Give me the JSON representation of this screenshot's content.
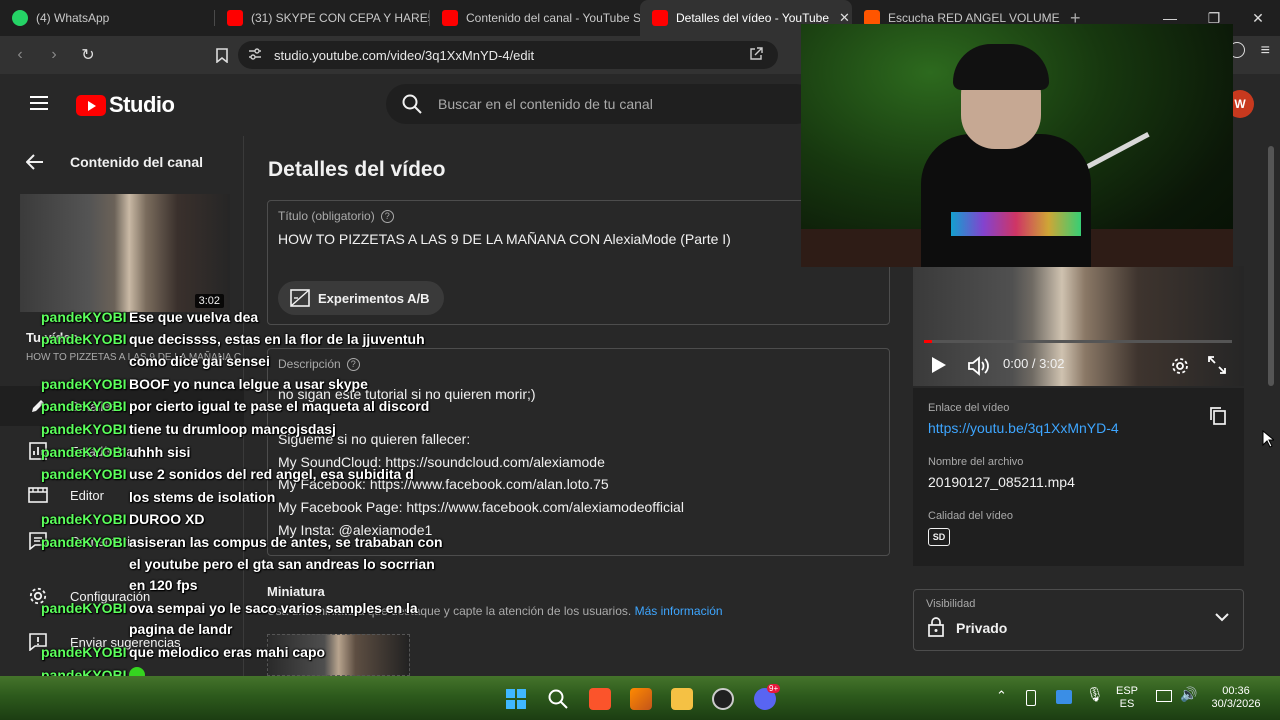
{
  "browser": {
    "tabs": [
      {
        "title": "(4) WhatsApp",
        "color": "#25d366"
      },
      {
        "title": "(31) SKYPE CON CEPA Y HARE5 | S",
        "color": "#ff0000"
      },
      {
        "title": "Contenido del canal - YouTube St",
        "color": "#ff0000"
      },
      {
        "title": "Detalles del vídeo - YouTube",
        "color": "#ff0000"
      },
      {
        "title": "Escucha RED ANGEL VOLUME III T",
        "color": "#ff5500"
      }
    ],
    "url": "studio.youtube.com/video/3q1XxMnYD-4/edit"
  },
  "studio": {
    "logo_text": "Studio",
    "search_placeholder": "Buscar en el contenido de tu canal",
    "avatar_initial": "W"
  },
  "sidebar": {
    "back_label": "Contenido del canal",
    "thumb_duration": "3:02",
    "video_label": "Tu vídeo",
    "video_sub": "HOW TO PIZZETAS A LAS 9 DE LA MAÑANA C",
    "items": [
      {
        "label": "Detalles",
        "icon": "pencil-icon"
      },
      {
        "label": "Estadísticas",
        "icon": "bar-chart-icon"
      },
      {
        "label": "Editor",
        "icon": "film-icon"
      },
      {
        "label": "Comentarios",
        "icon": "comment-icon"
      },
      {
        "label": "Configuración",
        "icon": "gear-icon"
      },
      {
        "label": "Enviar sugerencias",
        "icon": "feedback-icon"
      }
    ]
  },
  "main": {
    "page_title": "Detalles del vídeo",
    "title_label": "Título (obligatorio)",
    "title_value": "HOW TO PIZZETAS A LAS 9 DE LA MAÑANA CON AlexiaMode (Parte I)",
    "ab_button": "Experimentos A/B",
    "desc_label": "Descripción",
    "desc_lines": [
      "no sigan este tutorial si no quieren morir;)",
      "",
      "Sigueme si no quieren fallecer:",
      "My SoundCloud: https://soundcloud.com/alexiamode",
      "My Facebook: https://www.facebook.com/alan.loto.75",
      "My Facebook Page: https://www.facebook.com/alexiamodeofficial",
      "My Insta: @alexiamode1"
    ],
    "thumbnail_title": "Miniatura",
    "thumbnail_sub": "Usa una miniatura que destaque y capte la atención de los usuarios.",
    "thumbnail_link": "Más información"
  },
  "panel": {
    "time": "0:00 / 3:02",
    "progress": 0.0,
    "link_label": "Enlace del vídeo",
    "link_value": "https://youtu.be/3q1XxMnYD-4",
    "file_label": "Nombre del archivo",
    "file_value": "20190127_085211.mp4",
    "quality_label": "Calidad del vídeo",
    "quality_badge": "SD",
    "visibility_label": "Visibilidad",
    "visibility_value": "Privado"
  },
  "chat": [
    {
      "user": "pandeKYOBI",
      "text": "Ese que vuelva dea"
    },
    {
      "user": "pandeKYOBI",
      "text": "que decissss, estas en la flor de la jjuventuh"
    },
    {
      "user": "",
      "text": "como dice gai sensei"
    },
    {
      "user": "pandeKYOBI",
      "text": "BOOF yo nunca lelgue a usar skype"
    },
    {
      "user": "pandeKYOBI",
      "text": "por cierto igual te pase el maqueta al discord"
    },
    {
      "user": "pandeKYOBI",
      "text": "tiene tu drumloop mancojsdasj"
    },
    {
      "user": "pandeKYOBI",
      "text": "uhhh sisi"
    },
    {
      "user": "pandeKYOBI",
      "text": "use 2 sonidos del red angel, esa subidita d"
    },
    {
      "user": "",
      "text": "los stems de isolation"
    },
    {
      "user": "pandeKYOBI",
      "text": "DUROO XD"
    },
    {
      "user": "pandeKYOBI",
      "text": "asiseran las compus de antes, se trababan con"
    },
    {
      "user": "",
      "text": "el youtube pero el gta san andreas lo socrrian"
    },
    {
      "user": "",
      "text": "en 120 fps"
    },
    {
      "user": "pandeKYOBI",
      "text": "ova sempai yo le saco varios samples en la"
    },
    {
      "user": "",
      "text": "pagina de landr"
    },
    {
      "user": "pandeKYOBI",
      "text": "que melodico eras mahi capo"
    },
    {
      "user": "pandeKYOBI",
      "text": ""
    }
  ],
  "taskbar": {
    "lang_top": "ESP",
    "lang_bottom": "ES",
    "time": "00:36",
    "date": "30/3/2026",
    "discord_badge": "9+"
  }
}
